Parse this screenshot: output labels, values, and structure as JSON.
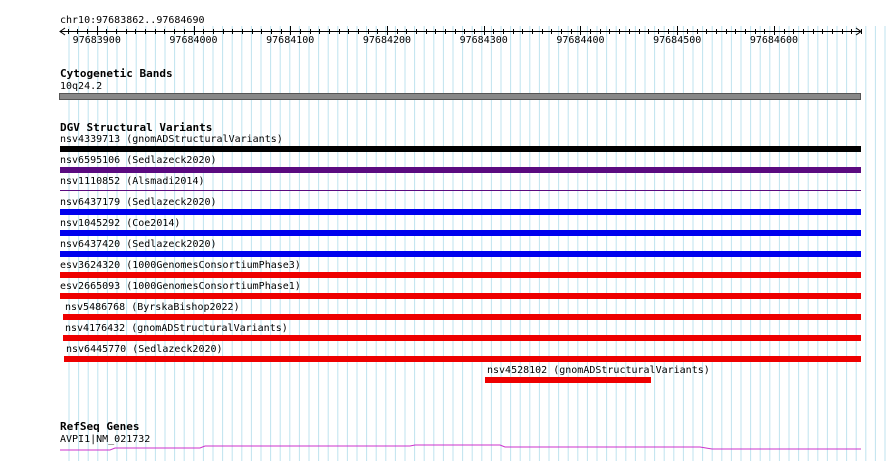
{
  "ruler": {
    "region": "chr10:97683862..97684690",
    "start": 97683862,
    "end": 97684690,
    "tick_labels": [
      "97683900",
      "97684000",
      "97684100",
      "97684200",
      "97684300",
      "97684400",
      "97684500",
      "97684600"
    ]
  },
  "cytoband": {
    "title": "Cytogenetic Bands",
    "band": "10q24.2",
    "color": "#888888"
  },
  "dgv": {
    "title": "DGV Structural Variants",
    "variants": [
      {
        "label": "nsv4339713 (gnomADStructuralVariants)",
        "color": "#000000",
        "start": 97683862,
        "end": 97684690,
        "thick": true
      },
      {
        "label": "nsv6595106 (Sedlazeck2020)",
        "color": "#5a0a80",
        "start": 97683862,
        "end": 97684690,
        "thick": true
      },
      {
        "label": "nsv1110852 (Alsmadi2014)",
        "color": "#5a0a80",
        "start": 97683862,
        "end": 97684690,
        "thick": false
      },
      {
        "label": "nsv6437179 (Sedlazeck2020)",
        "color": "#0000ee",
        "start": 97683862,
        "end": 97684690,
        "thick": true
      },
      {
        "label": "nsv1045292 (Coe2014)",
        "color": "#0000ee",
        "start": 97683862,
        "end": 97684690,
        "thick": true
      },
      {
        "label": "nsv6437420 (Sedlazeck2020)",
        "color": "#0000ee",
        "start": 97683862,
        "end": 97684690,
        "thick": true
      },
      {
        "label": "esv3624320 (1000GenomesConsortiumPhase3)",
        "color": "#ee0000",
        "start": 97683862,
        "end": 97684690,
        "thick": true
      },
      {
        "label": "esv2665093 (1000GenomesConsortiumPhase1)",
        "color": "#ee0000",
        "start": 97683862,
        "end": 97684690,
        "thick": true
      },
      {
        "label": "nsv5486768 (ByrskaBishop2022)",
        "color": "#ee0000",
        "start": 97683865,
        "end": 97684690,
        "thick": true
      },
      {
        "label": "nsv4176432 (gnomADStructuralVariants)",
        "color": "#ee0000",
        "start": 97683865,
        "end": 97684690,
        "thick": true
      },
      {
        "label": "nsv6445770 (Sedlazeck2020)",
        "color": "#ee0000",
        "start": 97683866,
        "end": 97684690,
        "thick": true
      },
      {
        "label": "nsv4528102 (gnomADStructuralVariants)",
        "color": "#ee0000",
        "start": 97684301,
        "end": 97684473,
        "thick": true
      }
    ]
  },
  "refseq": {
    "title": "RefSeq Genes",
    "gene": "AVPI1|NM_021732",
    "color": "#cc33cc"
  },
  "colors": {
    "grid": "#bfe3ef",
    "ruler": "#000000"
  }
}
